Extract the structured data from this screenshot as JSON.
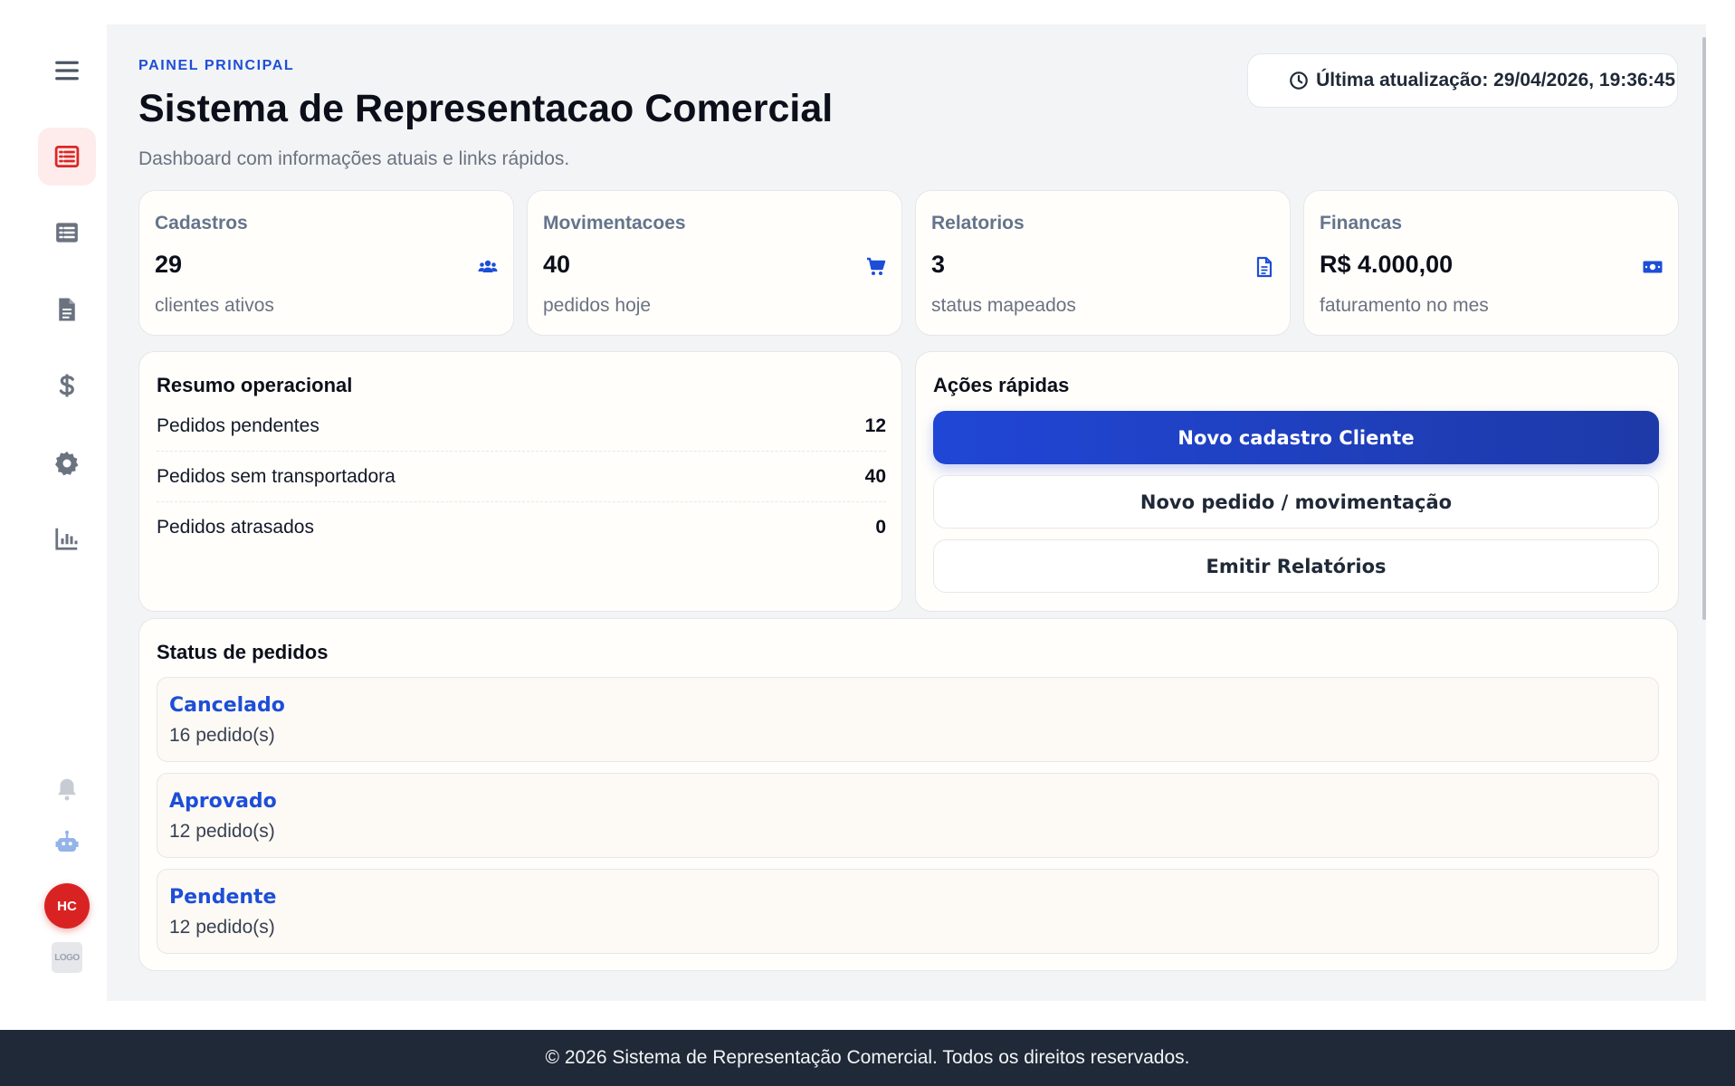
{
  "header": {
    "eyebrow": "PAINEL PRINCIPAL",
    "title": "Sistema de Representacao Comercial",
    "subtitle": "Dashboard com informações atuais e links rápidos.",
    "last_update": "Última atualização: 29/04/2026, 19:36:45"
  },
  "sidebar": {
    "items": [
      {
        "name": "menu",
        "icon": "hamburger-icon"
      },
      {
        "name": "dashboard",
        "icon": "list-alt-icon",
        "active": true
      },
      {
        "name": "lists",
        "icon": "list-icon"
      },
      {
        "name": "documents",
        "icon": "file-icon"
      },
      {
        "name": "finances",
        "icon": "dollar-icon"
      },
      {
        "name": "settings",
        "icon": "gear-icon"
      },
      {
        "name": "reports",
        "icon": "bar-chart-icon"
      }
    ],
    "bottom": {
      "notifications_icon": "bell-icon",
      "bot_icon": "robot-icon",
      "avatar_initials": "HC",
      "logo_text": "LOGO"
    }
  },
  "stats": [
    {
      "label": "Cadastros",
      "value": "29",
      "desc": "clientes ativos",
      "icon": "users-icon"
    },
    {
      "label": "Movimentacoes",
      "value": "40",
      "desc": "pedidos hoje",
      "icon": "cart-icon"
    },
    {
      "label": "Relatorios",
      "value": "3",
      "desc": "status mapeados",
      "icon": "file-text-icon"
    },
    {
      "label": "Financas",
      "value": "R$ 4.000,00",
      "desc": "faturamento no mes",
      "icon": "money-icon"
    }
  ],
  "resumo": {
    "title": "Resumo operacional",
    "rows": [
      {
        "label": "Pedidos pendentes",
        "value": "12"
      },
      {
        "label": "Pedidos sem transportadora",
        "value": "40"
      },
      {
        "label": "Pedidos atrasados",
        "value": "0"
      }
    ]
  },
  "acoes": {
    "title": "Ações rápidas",
    "buttons": [
      {
        "label": "Novo cadastro Cliente"
      },
      {
        "label": "Novo pedido / movimentação"
      },
      {
        "label": "Emitir Relatórios"
      }
    ]
  },
  "status": {
    "title": "Status de pedidos",
    "items": [
      {
        "name": "Cancelado",
        "count": "16 pedido(s)"
      },
      {
        "name": "Aprovado",
        "count": "12 pedido(s)"
      },
      {
        "name": "Pendente",
        "count": "12 pedido(s)"
      }
    ]
  },
  "footer": {
    "text": "© 2026 Sistema de Representação Comercial. Todos os direitos reservados."
  },
  "colors": {
    "accent": "#1d4ed8",
    "danger": "#d92323",
    "footer_bg": "#1f2937",
    "sidebar_icon": "#6b7280"
  }
}
